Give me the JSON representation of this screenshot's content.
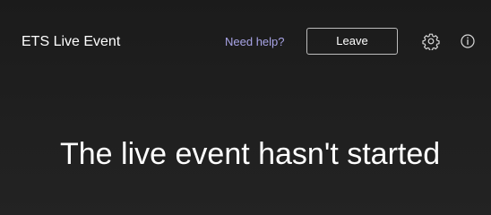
{
  "header": {
    "title": "ETS Live Event",
    "help_label": "Need help?",
    "leave_label": "Leave",
    "settings_icon": "gear-icon",
    "info_icon": "info-icon"
  },
  "main": {
    "message": "The live event hasn't started"
  },
  "colors": {
    "background": "#1f1f1f",
    "text": "#ffffff",
    "help_link": "#a8a4e6",
    "button_border": "#bcbcbc"
  }
}
